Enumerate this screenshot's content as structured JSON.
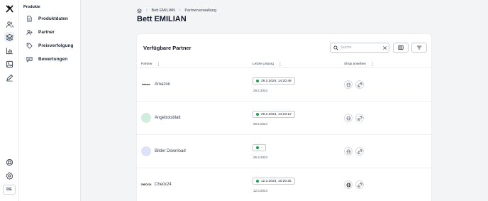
{
  "rail": {
    "lang_label": "DE"
  },
  "subnav": {
    "section_title": "Produkte",
    "items": [
      {
        "label": "Produktdaten",
        "icon": "document-icon"
      },
      {
        "label": "Partner",
        "icon": "user-plus-icon"
      },
      {
        "label": "Preisverfolgung",
        "icon": "tag-icon"
      },
      {
        "label": "Bewertungen",
        "icon": "review-icon"
      }
    ]
  },
  "breadcrumb": {
    "items": [
      "Bett EMILIAN",
      "Partnerverwaltung"
    ]
  },
  "page_title": "Bett EMILIAN",
  "card": {
    "title": "Verfügbare Partner",
    "search_placeholder": "Suche",
    "columns": [
      "Partner",
      "Letzte Listung",
      "Shop ansehen"
    ],
    "rows": [
      {
        "name": "Amazon",
        "logo_text": "amazon",
        "badge": "29.2.2024, 14:20:48",
        "date": "29.2.2024"
      },
      {
        "name": "Angebotsblatt",
        "logo_text": "",
        "badge": "29.2.2024, 14:23:12",
        "date": "29.2.2024"
      },
      {
        "name": "Bilder Download",
        "logo_text": "",
        "badge": "-",
        "date": "26.4.2023"
      },
      {
        "name": "Check24",
        "logo_text": "CHECK24",
        "badge": "12.3.2024, 10:20:25",
        "date": "12.3.2024"
      }
    ]
  },
  "colors": {
    "accent_green": "#16a34a",
    "background": "#f3f4f6"
  }
}
